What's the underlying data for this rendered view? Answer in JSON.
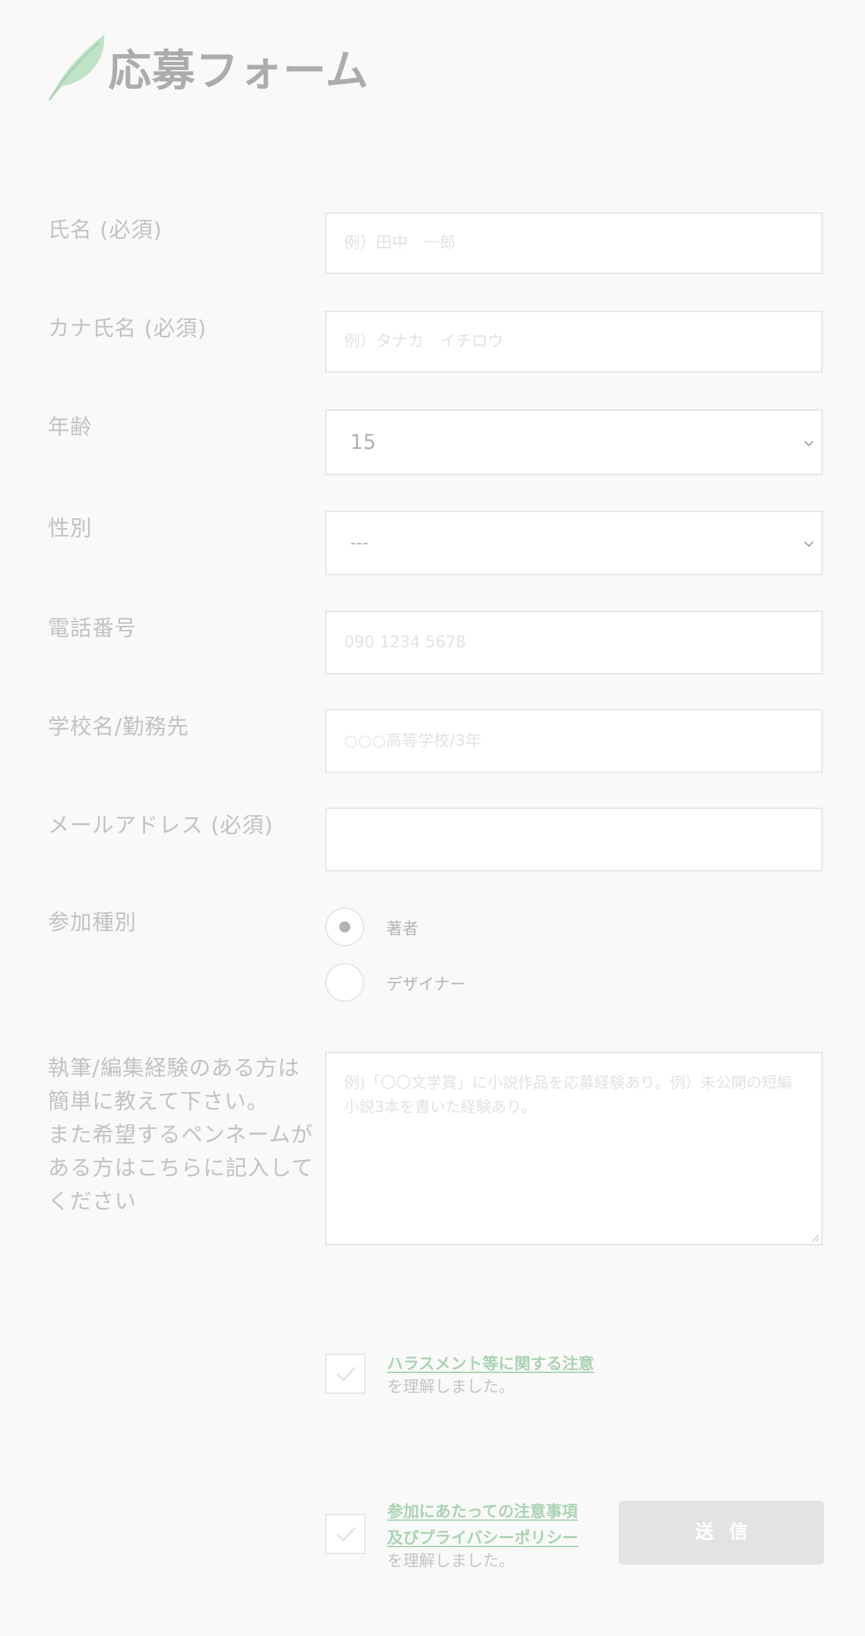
{
  "page": {
    "title": "応募フォーム",
    "logo_icon": "feather-quill-icon",
    "accent_color": "#a9d3b2"
  },
  "fields": {
    "name": {
      "label": "氏名 (必須)",
      "placeholder": "例）田中　一郎"
    },
    "kana": {
      "label": "カナ氏名 (必須)",
      "placeholder": "例）タナカ　イチロウ"
    },
    "age": {
      "label": "年齢",
      "value": "15"
    },
    "gender": {
      "label": "性別",
      "value": "---"
    },
    "phone": {
      "label": "電話番号",
      "placeholder": "090 1234 5678"
    },
    "school": {
      "label": "学校名/勤務先",
      "placeholder": "○○○高等学校/3年"
    },
    "email": {
      "label": "メールアドレス (必須)",
      "placeholder": ""
    },
    "participation": {
      "label": "参加種別",
      "options": [
        {
          "label": "著者",
          "selected": true
        },
        {
          "label": "デザイナー",
          "selected": false
        }
      ]
    },
    "experience": {
      "label_lines": [
        "執筆/編集経験のある方は",
        "簡単に教えて下さい。",
        "また希望するペンネームが",
        "ある方はこちらに記入して",
        "ください"
      ],
      "placeholder": "例)「〇〇文学賞」に小説作品を応募経験あり。例）未公開の短編小説3本を書いた経験あり。"
    }
  },
  "consents": {
    "harassment": {
      "link": "ハラスメント等に関する注意",
      "suffix": "を理解しました。",
      "checked": false
    },
    "privacy": {
      "link_line1": "参加にあたっての注意事項",
      "link_line2": "及びプライバシーポリシー",
      "suffix": "を理解しました。",
      "checked": false
    }
  },
  "submit": {
    "label": "送信"
  }
}
